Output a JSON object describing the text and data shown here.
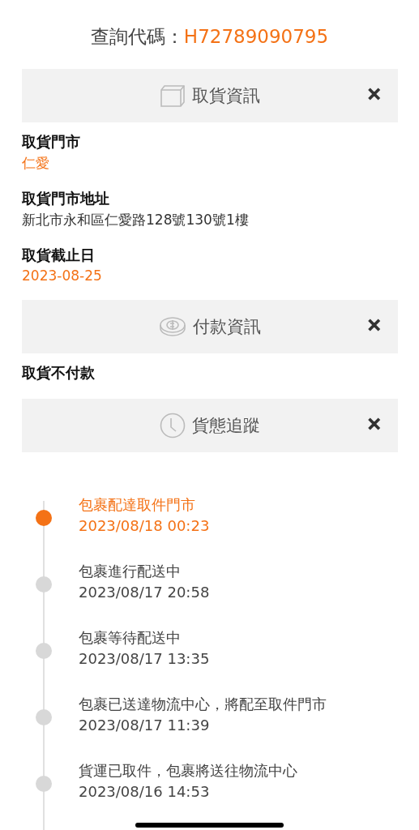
{
  "query": {
    "label": "查詢代碼：",
    "code": "H72789090795"
  },
  "sections": [
    {
      "kind": "pickup",
      "title": "取貨資訊",
      "close": "✕",
      "fields": [
        {
          "label": "取貨門市",
          "value": "仁愛",
          "highlight": true
        },
        {
          "label": "取貨門市地址",
          "value": "新北市永和區仁愛路128號130號1樓",
          "highlight": false
        },
        {
          "label": "取貨截止日",
          "value": "2023-08-25",
          "highlight": true
        }
      ]
    },
    {
      "kind": "payment",
      "title": "付款資訊",
      "close": "✕",
      "fields": [
        {
          "label": "取貨不付款"
        }
      ]
    },
    {
      "kind": "tracking",
      "title": "貨態追蹤",
      "close": "✕"
    }
  ],
  "timeline": [
    {
      "status": "包裹配達取件門市",
      "time": "2023/08/18 00:23",
      "selected": true
    },
    {
      "status": "包裹進行配送中",
      "time": "2023/08/17 20:58",
      "selected": false
    },
    {
      "status": "包裹等待配送中",
      "time": "2023/08/17 13:35",
      "selected": false
    },
    {
      "status": "包裹已送達物流中心，將配至取件門市",
      "time": "2023/08/17 11:39",
      "selected": false
    },
    {
      "status": "貨運已取件，包裹將送往物流中心",
      "time": "2023/08/16 14:53",
      "selected": false
    }
  ]
}
